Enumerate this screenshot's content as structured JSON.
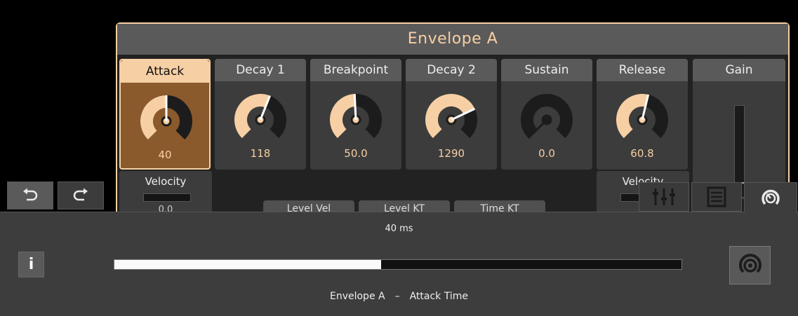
{
  "panel": {
    "title": "Envelope A",
    "params": [
      {
        "label": "Attack",
        "value": "40",
        "norm": 0.5,
        "active": true
      },
      {
        "label": "Decay 1",
        "value": "118",
        "norm": 0.58,
        "active": false
      },
      {
        "label": "Breakpoint",
        "value": "50.0",
        "norm": 0.49,
        "active": false
      },
      {
        "label": "Decay 2",
        "value": "1290",
        "norm": 0.74,
        "active": false
      },
      {
        "label": "Sustain",
        "value": "0.0",
        "norm": 0.0,
        "active": false
      },
      {
        "label": "Release",
        "value": "60.8",
        "norm": 0.55,
        "active": false
      }
    ],
    "gain": {
      "label": "Gain",
      "level": 0.48
    },
    "velocity_left": {
      "label": "Velocity",
      "value": "0.0"
    },
    "velocity_right": {
      "label": "Velocity"
    },
    "mod_tabs": [
      "Level Vel",
      "Level KT",
      "Time KT"
    ]
  },
  "history": {
    "undo_icon": "undo-icon",
    "redo_icon": "redo-icon"
  },
  "view_tabs": [
    "mixer-icon",
    "list-icon",
    "knob-icon"
  ],
  "bottom": {
    "readout": "40 ms",
    "slider_fraction": 0.47,
    "info_label": "i",
    "param_device": "Envelope A",
    "param_separator": "–",
    "param_name": "Attack Time"
  },
  "colors": {
    "accent": "#f6cfa4",
    "active_bg": "#8a5a2c"
  }
}
